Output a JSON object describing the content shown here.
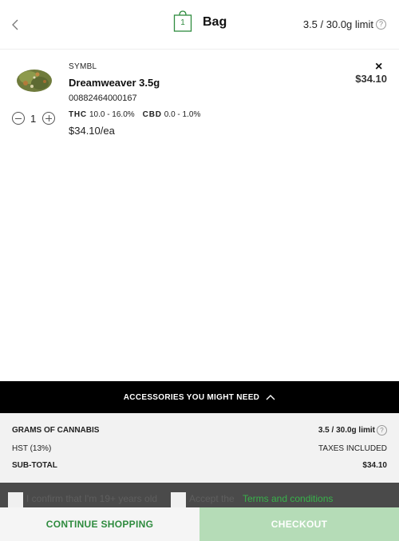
{
  "header": {
    "bag_count": "1",
    "title": "Bag",
    "limit": "3.5 / 30.0g limit",
    "help": "?"
  },
  "item": {
    "brand": "SYMBL",
    "name": "Dreamweaver 3.5g",
    "sku": "00882464000167",
    "thc_label": "THC",
    "thc_value": "10.0 - 16.0%",
    "cbd_label": "CBD",
    "cbd_value": "0.0 - 1.0%",
    "unit_price": "$34.10/ea",
    "quantity": "1",
    "remove": "×",
    "line_total": "$34.10"
  },
  "accessories": {
    "label": "ACCESSORIES YOU MIGHT NEED"
  },
  "summary": {
    "grams_label": "GRAMS OF CANNABIS",
    "grams_value": "3.5 / 30.0g limit",
    "help": "?",
    "tax_label": "HST (13%)",
    "tax_value": "TAXES INCLUDED",
    "subtotal_label": "SUB-TOTAL",
    "subtotal_value": "$34.10"
  },
  "consent": {
    "age_text": "I confirm that I'm 19+ years old",
    "accept_text": "Accept the",
    "terms_link": "Terms and conditions"
  },
  "actions": {
    "continue_label": "CONTINUE SHOPPING",
    "checkout_label": "CHECKOUT"
  },
  "colors": {
    "brand_green": "#2e8b3e",
    "link_green": "#38b24a",
    "checkout_disabled": "#b5dcb7"
  }
}
